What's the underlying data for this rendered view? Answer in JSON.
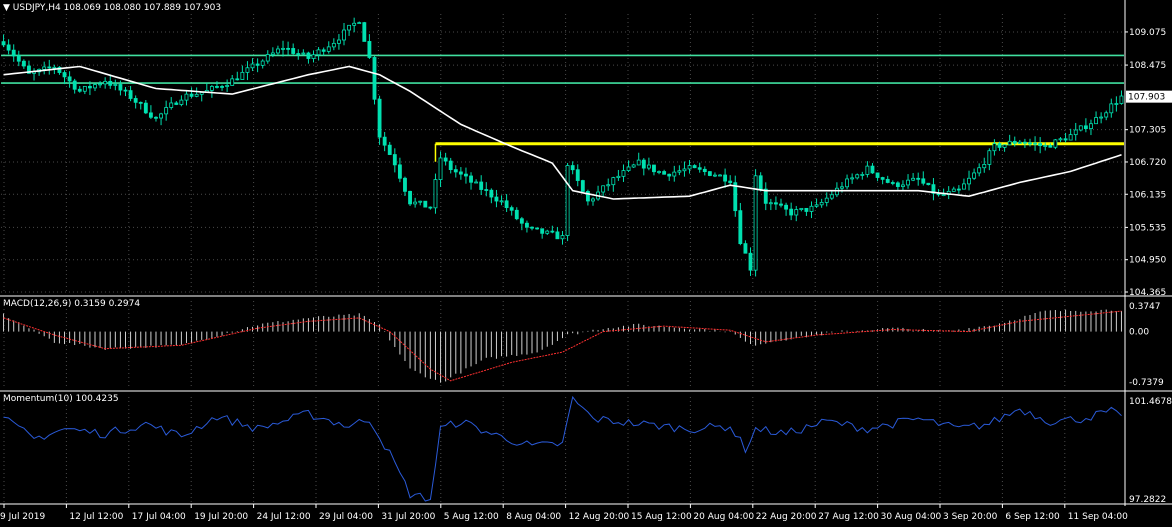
{
  "header": {
    "symbol": "USDJPY,H4",
    "ohlc": "108.069 108.080 107.889 107.903",
    "macd_title": "MACD(12,26,9) 0.3159 0.2974",
    "momentum_title": "Momentum(10) 100.4235"
  },
  "colors": {
    "background": "#000000",
    "grid": "#4a4a4a",
    "candle": "#00e0b0",
    "ma": "#ffffff",
    "resistance": "#40e0a0",
    "support": "#ffff00",
    "macd_signal": "#ff3030",
    "macd_hist": "#d0d0d0",
    "momentum": "#2a5ad8",
    "price_box_bg": "#ffffff",
    "price_box_fg": "#000000"
  },
  "chart_data": [
    {
      "type": "candlestick",
      "title": "USDJPY,H4",
      "price_ticks": [
        "109.075",
        "108.475",
        "107.305",
        "106.720",
        "106.135",
        "105.535",
        "104.950",
        "104.365"
      ],
      "current_price": "107.903",
      "ylim": [
        104.365,
        109.4
      ],
      "time_labels": [
        "9 Jul 2019",
        "12 Jul 12:00",
        "17 Jul 04:00",
        "19 Jul 20:00",
        "24 Jul 12:00",
        "29 Jul 04:00",
        "31 Jul 20:00",
        "5 Aug 12:00",
        "8 Aug 04:00",
        "12 Aug 20:00",
        "15 Aug 12:00",
        "20 Aug 04:00",
        "22 Aug 20:00",
        "27 Aug 12:00",
        "30 Aug 04:00",
        "3 Sep 20:00",
        "6 Sep 12:00",
        "11 Sep 04:00"
      ],
      "levels": [
        {
          "name": "resistance-upper",
          "price": 108.65,
          "color": "#40e0a0"
        },
        {
          "name": "resistance-lower",
          "price": 108.15,
          "color": "#40e0a0"
        },
        {
          "name": "support-yellow",
          "price": 107.05,
          "start_index": 85,
          "color": "#ffff00"
        }
      ],
      "price_anchors": [
        [
          0,
          108.9
        ],
        [
          5,
          108.3
        ],
        [
          10,
          108.45
        ],
        [
          15,
          108.0
        ],
        [
          20,
          108.2
        ],
        [
          25,
          107.9
        ],
        [
          30,
          107.5
        ],
        [
          35,
          107.9
        ],
        [
          40,
          108.0
        ],
        [
          45,
          108.2
        ],
        [
          50,
          108.5
        ],
        [
          55,
          108.8
        ],
        [
          60,
          108.6
        ],
        [
          65,
          108.9
        ],
        [
          70,
          109.3
        ],
        [
          72,
          108.6
        ],
        [
          74,
          107.2
        ],
        [
          77,
          106.7
        ],
        [
          80,
          106.0
        ],
        [
          84,
          105.9
        ],
        [
          86,
          106.8
        ],
        [
          88,
          106.6
        ],
        [
          93,
          106.3
        ],
        [
          98,
          106.0
        ],
        [
          103,
          105.5
        ],
        [
          108,
          105.4
        ],
        [
          110,
          105.35
        ],
        [
          111,
          106.7
        ],
        [
          115,
          106.0
        ],
        [
          120,
          106.4
        ],
        [
          125,
          106.7
        ],
        [
          130,
          106.5
        ],
        [
          135,
          106.6
        ],
        [
          140,
          106.5
        ],
        [
          143,
          106.4
        ],
        [
          145,
          105.3
        ],
        [
          147,
          104.8
        ],
        [
          148,
          106.5
        ],
        [
          150,
          106.0
        ],
        [
          155,
          105.8
        ],
        [
          160,
          105.9
        ],
        [
          165,
          106.3
        ],
        [
          170,
          106.6
        ],
        [
          175,
          106.3
        ],
        [
          180,
          106.4
        ],
        [
          184,
          106.1
        ],
        [
          188,
          106.2
        ],
        [
          192,
          106.6
        ],
        [
          195,
          107.0
        ],
        [
          200,
          107.1
        ],
        [
          205,
          107.0
        ],
        [
          210,
          107.2
        ],
        [
          215,
          107.5
        ],
        [
          220,
          107.9
        ]
      ],
      "moving_average": [
        [
          0,
          108.3
        ],
        [
          15,
          108.45
        ],
        [
          30,
          108.05
        ],
        [
          45,
          107.95
        ],
        [
          60,
          108.3
        ],
        [
          68,
          108.45
        ],
        [
          74,
          108.3
        ],
        [
          80,
          108.0
        ],
        [
          90,
          107.4
        ],
        [
          100,
          107.0
        ],
        [
          108,
          106.7
        ],
        [
          112,
          106.2
        ],
        [
          120,
          106.05
        ],
        [
          135,
          106.1
        ],
        [
          143,
          106.3
        ],
        [
          150,
          106.2
        ],
        [
          165,
          106.2
        ],
        [
          180,
          106.2
        ],
        [
          190,
          106.1
        ],
        [
          200,
          106.35
        ],
        [
          210,
          106.55
        ],
        [
          220,
          106.85
        ]
      ]
    },
    {
      "type": "bar",
      "title": "MACD(12,26,9) 0.3159 0.2974",
      "ticks": [
        "0.3747",
        "0.00",
        "-0.7379"
      ],
      "ylim": [
        -0.7379,
        0.3747
      ],
      "histogram_anchors": [
        [
          0,
          0.25
        ],
        [
          10,
          -0.15
        ],
        [
          20,
          -0.25
        ],
        [
          35,
          -0.2
        ],
        [
          50,
          0.1
        ],
        [
          60,
          0.2
        ],
        [
          70,
          0.25
        ],
        [
          74,
          0.1
        ],
        [
          80,
          -0.55
        ],
        [
          86,
          -0.75
        ],
        [
          95,
          -0.4
        ],
        [
          105,
          -0.3
        ],
        [
          111,
          -0.05
        ],
        [
          118,
          0.05
        ],
        [
          125,
          0.1
        ],
        [
          135,
          0.05
        ],
        [
          143,
          0.0
        ],
        [
          147,
          -0.2
        ],
        [
          155,
          -0.1
        ],
        [
          165,
          0.0
        ],
        [
          175,
          0.05
        ],
        [
          185,
          0.0
        ],
        [
          195,
          0.1
        ],
        [
          205,
          0.3
        ],
        [
          220,
          0.32
        ]
      ],
      "signal_anchors": [
        [
          0,
          0.2
        ],
        [
          10,
          -0.05
        ],
        [
          20,
          -0.25
        ],
        [
          35,
          -0.2
        ],
        [
          50,
          0.05
        ],
        [
          60,
          0.15
        ],
        [
          70,
          0.2
        ],
        [
          76,
          0.0
        ],
        [
          84,
          -0.55
        ],
        [
          88,
          -0.72
        ],
        [
          100,
          -0.45
        ],
        [
          110,
          -0.3
        ],
        [
          118,
          0.0
        ],
        [
          130,
          0.08
        ],
        [
          143,
          0.02
        ],
        [
          150,
          -0.15
        ],
        [
          160,
          -0.05
        ],
        [
          175,
          0.03
        ],
        [
          190,
          0.0
        ],
        [
          200,
          0.15
        ],
        [
          220,
          0.3
        ]
      ]
    },
    {
      "type": "line",
      "title": "Momentum(10) 100.4235",
      "ticks": [
        "101.4678",
        "97.2822"
      ],
      "ylim": [
        97.2822,
        101.4678
      ],
      "anchors": [
        [
          0,
          100.6
        ],
        [
          6,
          99.8
        ],
        [
          12,
          100.2
        ],
        [
          20,
          100.0
        ],
        [
          28,
          100.4
        ],
        [
          35,
          99.9
        ],
        [
          42,
          100.7
        ],
        [
          50,
          100.2
        ],
        [
          60,
          100.8
        ],
        [
          68,
          100.3
        ],
        [
          72,
          100.6
        ],
        [
          76,
          99.2
        ],
        [
          80,
          97.6
        ],
        [
          84,
          97.4
        ],
        [
          86,
          100.2
        ],
        [
          90,
          100.5
        ],
        [
          96,
          100.0
        ],
        [
          104,
          99.5
        ],
        [
          110,
          99.6
        ],
        [
          112,
          101.4
        ],
        [
          116,
          100.6
        ],
        [
          125,
          100.4
        ],
        [
          135,
          100.2
        ],
        [
          143,
          100.3
        ],
        [
          146,
          99.4
        ],
        [
          148,
          100.2
        ],
        [
          154,
          100.0
        ],
        [
          162,
          100.5
        ],
        [
          170,
          100.2
        ],
        [
          180,
          100.6
        ],
        [
          188,
          100.2
        ],
        [
          194,
          100.4
        ],
        [
          200,
          101.0
        ],
        [
          206,
          100.5
        ],
        [
          212,
          100.6
        ],
        [
          218,
          100.9
        ],
        [
          220,
          100.6
        ]
      ]
    }
  ]
}
